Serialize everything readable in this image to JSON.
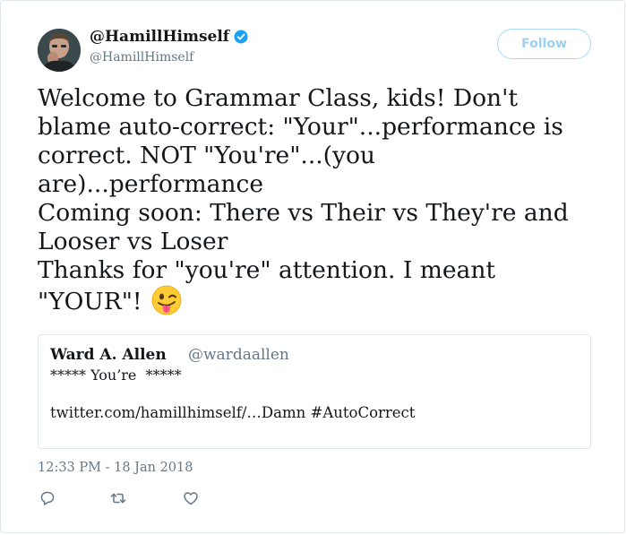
{
  "author": {
    "display_name": "@HamillHimself",
    "handle": "@HamillHimself",
    "verified_icon": "verified-badge-icon"
  },
  "follow_label": "Follow",
  "tweet": {
    "lines": [
      "Welcome to Grammar Class, kids! Don't",
      "blame auto-correct: \"Your\"...performance is",
      "correct. NOT \"You're\"...(you",
      "are)...performance",
      "Coming soon: There vs Their vs They're and",
      "Looser vs Loser",
      "Thanks for \"you're\" attention. I meant",
      "\"YOUR\"!"
    ],
    "emoji": "winking-face-with-tongue"
  },
  "quote": {
    "name": "Ward A. Allen",
    "handle": "@wardaallen",
    "line1": "***** You’re  *****",
    "line2": "twitter.com/hamillhimself/…Damn #AutoCorrect"
  },
  "timestamp": "12:33 PM - 18 Jan 2018",
  "actions": [
    "reply-icon",
    "retweet-icon",
    "like-icon"
  ],
  "colors": {
    "link_blue": "#1da1f2",
    "follow_text": "#9bd0f3",
    "muted": "#657786",
    "text": "#14171a"
  }
}
